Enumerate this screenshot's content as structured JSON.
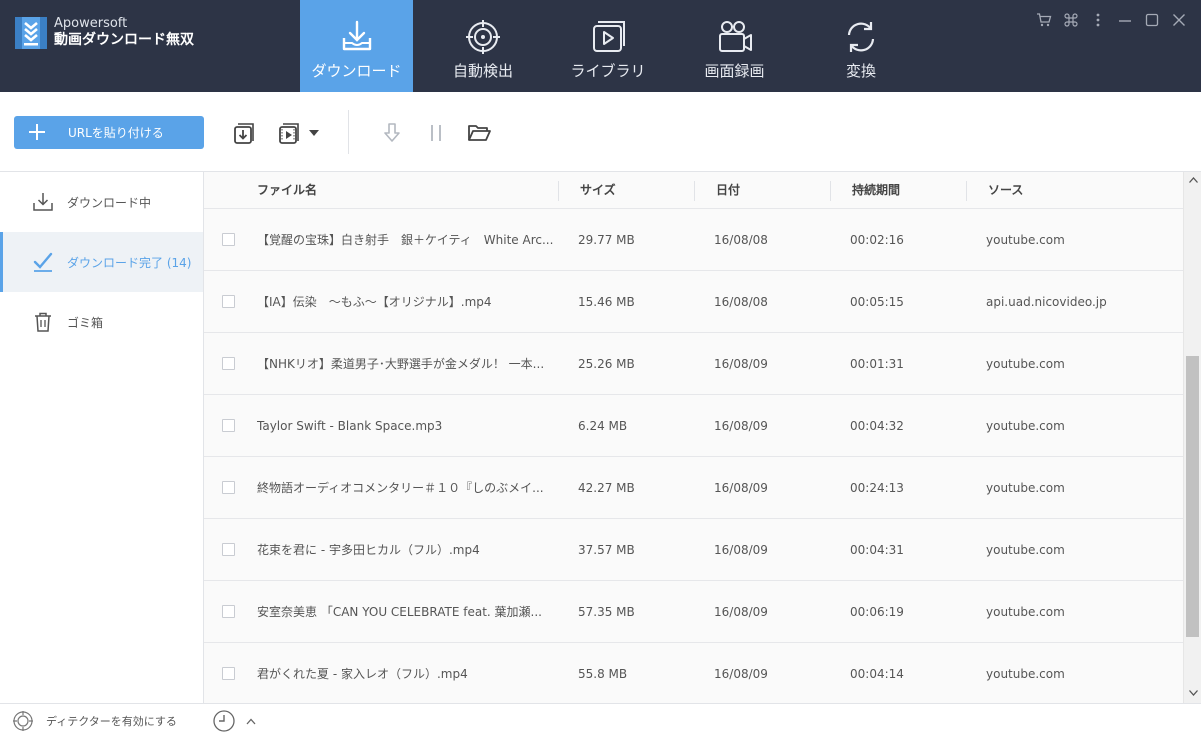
{
  "brand": {
    "name": "Apowersoft",
    "product": "動画ダウンロード無双"
  },
  "nav": [
    {
      "label": "ダウンロード",
      "icon": "download-tray-icon",
      "active": true
    },
    {
      "label": "自動検出",
      "icon": "target-icon",
      "active": false
    },
    {
      "label": "ライブラリ",
      "icon": "library-play-icon",
      "active": false
    },
    {
      "label": "画面録画",
      "icon": "video-camera-icon",
      "active": false
    },
    {
      "label": "変換",
      "icon": "convert-icon",
      "active": false
    }
  ],
  "window_controls": [
    "cart-icon",
    "command-icon",
    "more-icon",
    "minimize-icon",
    "maximize-icon",
    "close-icon"
  ],
  "toolbar": {
    "paste_label": "URLを貼り付ける",
    "icons": [
      "download-box-icon",
      "video-format-icon",
      "dropdown-arrow-icon",
      "resume-download-icon",
      "pause-icon",
      "open-folder-icon"
    ]
  },
  "sidebar": {
    "items": [
      {
        "label": "ダウンロード中",
        "icon": "download-icon",
        "active": false
      },
      {
        "label": "ダウンロード完了 (14)",
        "icon": "checkmark-icon",
        "active": true
      },
      {
        "label": "ゴミ箱",
        "icon": "trash-icon",
        "active": false
      }
    ]
  },
  "table": {
    "headers": [
      "ファイル名",
      "サイズ",
      "日付",
      "持続期間",
      "ソース"
    ],
    "rows": [
      {
        "name": "【覚醒の宝珠】白き射手　銀＋ケイティ　White Arc...",
        "size": "29.77 MB",
        "date": "16/08/08",
        "duration": "00:02:16",
        "source": "youtube.com"
      },
      {
        "name": "【IA】伝染　～もふ～【オリジナル】.mp4",
        "size": "15.46 MB",
        "date": "16/08/08",
        "duration": "00:05:15",
        "source": "api.uad.nicovideo.jp"
      },
      {
        "name": "【NHKリオ】柔道男子･大野選手が金メダル！ 一本...",
        "size": "25.26 MB",
        "date": "16/08/09",
        "duration": "00:01:31",
        "source": "youtube.com"
      },
      {
        "name": "Taylor Swift - Blank Space.mp3",
        "size": "6.24 MB",
        "date": "16/08/09",
        "duration": "00:04:32",
        "source": "youtube.com"
      },
      {
        "name": "終物語オーディオコメンタリー＃１０『しのぶメイ...",
        "size": "42.27 MB",
        "date": "16/08/09",
        "duration": "00:24:13",
        "source": "youtube.com"
      },
      {
        "name": "花束を君に - 宇多田ヒカル（フル）.mp4",
        "size": "37.57 MB",
        "date": "16/08/09",
        "duration": "00:04:31",
        "source": "youtube.com"
      },
      {
        "name": "安室奈美恵 「CAN YOU CELEBRATE feat. 葉加瀬...",
        "size": "57.35 MB",
        "date": "16/08/09",
        "duration": "00:06:19",
        "source": "youtube.com"
      },
      {
        "name": "君がくれた夏 - 家入レオ（フル）.mp4",
        "size": "55.8 MB",
        "date": "16/08/09",
        "duration": "00:04:14",
        "source": "youtube.com"
      }
    ]
  },
  "statusbar": {
    "detector_label": "ディテクターを有効にする",
    "icons": [
      "detector-icon",
      "clock-icon",
      "chevron-up-icon"
    ]
  },
  "colors": {
    "topbar": "#2d3446",
    "accent": "#5aa3e8",
    "row_bg": "#fafafa"
  }
}
